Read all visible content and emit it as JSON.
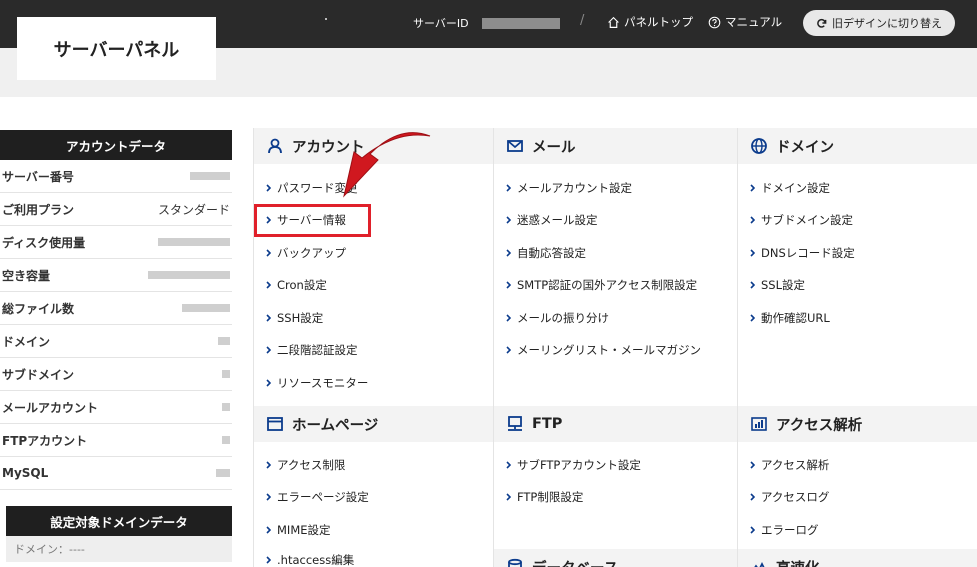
{
  "header": {
    "logo": "サーバーパネル",
    "server_id_label": "サーバーID",
    "separator": "/",
    "nav": [
      {
        "label": "パネルトップ",
        "icon": "home-icon"
      },
      {
        "label": "マニュアル",
        "icon": "help-circle-icon"
      }
    ],
    "old_design_label": "旧デザインに切り替え"
  },
  "sidebar": {
    "account_title": "アカウントデータ",
    "rows": [
      {
        "label": "サーバー番号",
        "value": ""
      },
      {
        "label": "ご利用プラン",
        "value": "スタンダード"
      },
      {
        "label": "ディスク使用量",
        "value": ""
      },
      {
        "label": "空き容量",
        "value": ""
      },
      {
        "label": "総ファイル数",
        "value": ""
      },
      {
        "label": "ドメイン",
        "value": ""
      },
      {
        "label": "サブドメイン",
        "value": ""
      },
      {
        "label": "メールアカウント",
        "value": ""
      },
      {
        "label": "FTPアカウント",
        "value": ""
      },
      {
        "label": "MySQL",
        "value": ""
      }
    ],
    "domain_title": "設定対象ドメインデータ",
    "domain_label": "ドメイン：----"
  },
  "sections": {
    "account": {
      "title": "アカウント",
      "items": [
        "パスワード変更",
        "サーバー情報",
        "バックアップ",
        "Cron設定",
        "SSH設定",
        "二段階認証設定",
        "リソースモニター"
      ]
    },
    "mail": {
      "title": "メール",
      "items": [
        "メールアカウント設定",
        "迷惑メール設定",
        "自動応答設定",
        "SMTP認証の国外アクセス制限設定",
        "メールの振り分け",
        "メーリングリスト・メールマガジン"
      ]
    },
    "domain": {
      "title": "ドメイン",
      "items": [
        "ドメイン設定",
        "サブドメイン設定",
        "DNSレコード設定",
        "SSL設定",
        "動作確認URL"
      ]
    },
    "homepage": {
      "title": "ホームページ",
      "items": [
        "アクセス制限",
        "エラーページ設定",
        "MIME設定",
        ".htaccess編集"
      ]
    },
    "ftp": {
      "title": "FTP",
      "items": [
        "サブFTPアカウント設定",
        "FTP制限設定"
      ]
    },
    "analytics": {
      "title": "アクセス解析",
      "items": [
        "アクセス解析",
        "アクセスログ",
        "エラーログ"
      ]
    },
    "database": {
      "title": "データベース"
    },
    "speed": {
      "title": "高速化"
    }
  },
  "colors": {
    "accent": "#0b3b8c",
    "highlight": "#e0202a",
    "dark": "#2a2a2a"
  }
}
